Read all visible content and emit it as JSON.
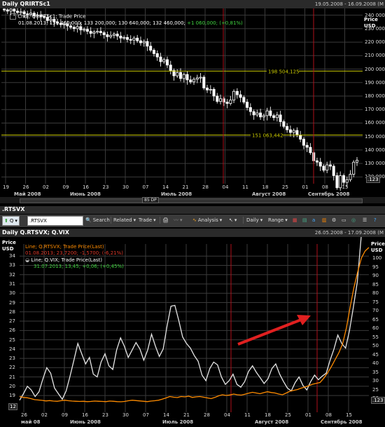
{
  "top": {
    "title": "Daily QRIRTSc1",
    "date_range": "19.05.2008 - 16.09.2008 (M",
    "legend_line1": "Cndl; QRIRTSc1; Trade Price",
    "legend_values": "01.08.2013; 131 460,000; 133 200,000; 130 640,000; 132 460,000;",
    "legend_change": "+1 060,000; (+0,81%)",
    "price_label": "Price",
    "currency": "USD",
    "y_ticks": [
      "240 000",
      "230 000",
      "220 000",
      "210 000",
      "200 000",
      "190 000",
      "180 000",
      "170 000",
      "160 000",
      "150 000",
      "140 000",
      "130 000",
      "120 000"
    ],
    "y_tick_values": [
      240000,
      230000,
      220000,
      210000,
      200000,
      190000,
      180000,
      170000,
      160000,
      150000,
      140000,
      130000,
      120000
    ],
    "y_axis_end": ".123",
    "x_ticks": [
      "19",
      "26",
      "02",
      "09",
      "16",
      "23",
      "30",
      "07",
      "14",
      "21",
      "28",
      "04",
      "11",
      "18",
      "25",
      "01",
      "08",
      "15"
    ],
    "months": [
      "Май 2008",
      "Июнь 2008",
      "Июль 2008",
      "Август 2008",
      "Сентябрь 2008"
    ],
    "zoom_label": "85 DP",
    "colors": {
      "candle_up": "#ffffff",
      "candle_down": "#ffffff",
      "hline": "#c8c800",
      "vline": "#b0101a",
      "label_bg": "#c8c800"
    }
  },
  "chart_data": [
    {
      "type": "candlestick",
      "title": "Daily QRIRTSc1",
      "ylabel": "Price USD",
      "ylim": [
        115000,
        245000
      ],
      "x": [
        "2008-05-19",
        "2008-05-20",
        "2008-05-21",
        "2008-05-22",
        "2008-05-23",
        "2008-05-26",
        "2008-05-27",
        "2008-05-28",
        "2008-05-29",
        "2008-05-30",
        "2008-06-02",
        "2008-06-03",
        "2008-06-04",
        "2008-06-05",
        "2008-06-06",
        "2008-06-09",
        "2008-06-10",
        "2008-06-11",
        "2008-06-12",
        "2008-06-13",
        "2008-06-16",
        "2008-06-17",
        "2008-06-18",
        "2008-06-19",
        "2008-06-20",
        "2008-06-23",
        "2008-06-24",
        "2008-06-25",
        "2008-06-26",
        "2008-06-27",
        "2008-06-30",
        "2008-07-01",
        "2008-07-02",
        "2008-07-03",
        "2008-07-04",
        "2008-07-07",
        "2008-07-08",
        "2008-07-09",
        "2008-07-10",
        "2008-07-11",
        "2008-07-14",
        "2008-07-15",
        "2008-07-16",
        "2008-07-17",
        "2008-07-18",
        "2008-07-21",
        "2008-07-22",
        "2008-07-23",
        "2008-07-24",
        "2008-07-25",
        "2008-07-28",
        "2008-07-29",
        "2008-07-30",
        "2008-07-31",
        "2008-08-01",
        "2008-08-04",
        "2008-08-05",
        "2008-08-06",
        "2008-08-07",
        "2008-08-08",
        "2008-08-11",
        "2008-08-12",
        "2008-08-13",
        "2008-08-14",
        "2008-08-15",
        "2008-08-18",
        "2008-08-19",
        "2008-08-20",
        "2008-08-21",
        "2008-08-22",
        "2008-08-25",
        "2008-08-26",
        "2008-08-27",
        "2008-08-28",
        "2008-08-29",
        "2008-09-01",
        "2008-09-02",
        "2008-09-03",
        "2008-09-04",
        "2008-09-05",
        "2008-09-08",
        "2008-09-09",
        "2008-09-10",
        "2008-09-11",
        "2008-09-12",
        "2008-09-15",
        "2008-09-16"
      ],
      "close": [
        244000,
        243000,
        244500,
        243000,
        242000,
        242500,
        241000,
        240500,
        241500,
        239500,
        240000,
        239000,
        238500,
        236000,
        237000,
        235000,
        234000,
        233000,
        233500,
        232000,
        231000,
        230000,
        231500,
        229000,
        229500,
        228000,
        226500,
        227500,
        228000,
        227000,
        225500,
        224000,
        225000,
        226000,
        224500,
        223000,
        223500,
        222000,
        221500,
        223000,
        221000,
        219500,
        220500,
        217000,
        214000,
        211500,
        209000,
        205500,
        207000,
        203000,
        199000,
        195000,
        197500,
        193000,
        196000,
        192000,
        190500,
        192500,
        193500,
        194000,
        186000,
        184500,
        185000,
        180000,
        176000,
        178000,
        175500,
        174500,
        177000,
        183500,
        181000,
        179000,
        175500,
        171500,
        168500,
        166000,
        167500,
        164500,
        165500,
        169000,
        165500,
        164000,
        166000,
        161000,
        157500,
        155000,
        153000,
        154500,
        151000,
        148000,
        143500,
        142000,
        138000,
        132000,
        131000,
        128000,
        125000,
        129000,
        128000,
        121000,
        112000,
        121000,
        116000,
        118000,
        122000,
        131000,
        132460
      ],
      "series_note": "approximate daily closes (values read from chart)",
      "hlines": [
        198504.125,
        151063.442
      ],
      "hline_labels": [
        "198 504,125",
        "151 063,442"
      ]
    },
    {
      "type": "line",
      "title": "Daily Q.RTSVX; Q.VIX",
      "series": [
        {
          "name": "Line; Q.RTSVX; Trade Price(Last)",
          "color": "#ff8c00",
          "values": [
            21,
            20.5,
            20.3,
            19.8,
            19.2,
            19,
            18.8,
            18.5,
            18.7,
            18.4,
            18.3,
            18.6,
            18.9,
            18.6,
            18.4,
            18.3,
            18.2,
            18.3,
            18.1,
            18.2,
            18.4,
            18.3,
            18.2,
            18.1,
            18.4,
            18.3,
            18.1,
            18.0,
            18.2,
            18.6,
            18.9,
            18.7,
            18.5,
            18.3,
            18.1,
            18.4,
            18.6,
            18.9,
            19.5,
            20.2,
            21.0,
            20.6,
            20.4,
            21.0,
            20.8,
            21.2,
            20.5,
            20.8,
            21.0,
            20.6,
            20.2,
            19.8,
            20.5,
            21.4,
            22.0,
            21.6,
            21.9,
            22.4,
            22.0,
            21.8,
            22.3,
            22.9,
            23.4,
            23.0,
            22.6,
            23.2,
            23.7,
            23.3,
            23.0,
            22.4,
            22.0,
            23.0,
            24.0,
            24.5,
            25.0,
            25.8,
            26.4,
            27.2,
            28.0,
            28.5,
            29.0,
            31.5,
            34.5,
            38.0,
            42.0,
            46.0,
            51.0,
            60.0,
            72.0,
            83.0,
            92.0,
            100.0,
            104.0,
            106.0
          ]
        },
        {
          "name": "Line; Q.VIX; Trade Price(Last)",
          "color": "#e6e6e6",
          "values": [
            18.5,
            19.2,
            20.0,
            19.6,
            18.9,
            19.4,
            20.8,
            22.0,
            21.4,
            19.8,
            19.2,
            18.6,
            19.5,
            21.1,
            22.8,
            24.6,
            23.5,
            22.4,
            23.1,
            21.3,
            21.0,
            22.6,
            23.5,
            22.2,
            21.8,
            23.9,
            25.2,
            24.3,
            23.1,
            23.9,
            24.7,
            24.0,
            22.8,
            23.9,
            25.6,
            24.3,
            23.2,
            24.0,
            26.5,
            28.6,
            28.7,
            27.1,
            25.3,
            24.6,
            24.1,
            23.3,
            22.7,
            21.2,
            20.6,
            21.9,
            22.6,
            22.3,
            21.0,
            20.2,
            20.6,
            21.3,
            20.2,
            19.9,
            20.5,
            21.6,
            22.2,
            21.5,
            20.9,
            20.3,
            20.8,
            21.9,
            22.4,
            21.3,
            20.5,
            19.8,
            19.5,
            20.4,
            21.0,
            20.1,
            19.6,
            20.5,
            21.2,
            20.7,
            21.1,
            21.4,
            22.8,
            24.0,
            25.5,
            24.6,
            24.1,
            26.0,
            28.5,
            31.2,
            36.0,
            42.0,
            47.0
          ]
        }
      ],
      "legend_values": [
        "01.08.2013; 23,7200; -1,5700; (-6,21%)",
        "31.07.2013; 13,45; +0,06; (+0,45%)"
      ]
    }
  ],
  "mid": {
    "ric": ".RTSVX",
    "toolbar": {
      "ric_box": ".RTSVX",
      "q_label": "Q",
      "search": "Search",
      "related": "Related",
      "trade": "Trade",
      "analysis": "Analysis",
      "daily": "Daily",
      "range": "Range"
    }
  },
  "bottom": {
    "title": "Daily Q.RTSVX; Q.VIX",
    "date_range": "26.05.2008 - 17.09.2008 (M",
    "legend1_line": "Line; Q.RTSVX; Trade Price(Last)",
    "legend1_values": "01.08.2013; 23,7200; -1,5700; (-6,21%)",
    "legend2_line": "Line; Q.VIX; Trade Price(Last)",
    "legend2_values": "31.07.2013; 13,45; +0,06; (+0,45%)",
    "price_label_left": "Price",
    "currency_left": "USD",
    "price_label_right": "Price",
    "currency_right": "USD",
    "y_ticks_left": [
      "34",
      "33",
      "32",
      "31",
      "30",
      "29",
      "28",
      "27",
      "26",
      "25",
      "24",
      "23",
      "22",
      "21",
      "20",
      "19"
    ],
    "y_tick_left_values": [
      34,
      33,
      32,
      31,
      30,
      29,
      28,
      27,
      26,
      25,
      24,
      23,
      22,
      21,
      20,
      19
    ],
    "y_axis_start_left": "12",
    "y_ticks_right": [
      "100",
      "95",
      "90",
      "85",
      "80",
      "75",
      "70",
      "65",
      "60",
      "55",
      "50",
      "45",
      "40",
      "35",
      "30",
      "25",
      "20"
    ],
    "y_tick_right_values": [
      100,
      95,
      90,
      85,
      80,
      75,
      70,
      65,
      60,
      55,
      50,
      45,
      40,
      35,
      30,
      25,
      20
    ],
    "y_axis_end_right": ".123",
    "x_ticks": [
      "26",
      "02",
      "09",
      "16",
      "23",
      "30",
      "07",
      "14",
      "21",
      "28",
      "04",
      "11",
      "18",
      "25",
      "01",
      "08",
      "15"
    ],
    "months": [
      "май 08",
      "Июнь 2008",
      "Июль 2008",
      "Август 2008",
      "Сентябрь 2008"
    ],
    "colors": {
      "rtsvx": "#ff8c00",
      "vix": "#e6e6e6",
      "arrow": "#e02020",
      "vline": "#b0101a"
    }
  }
}
